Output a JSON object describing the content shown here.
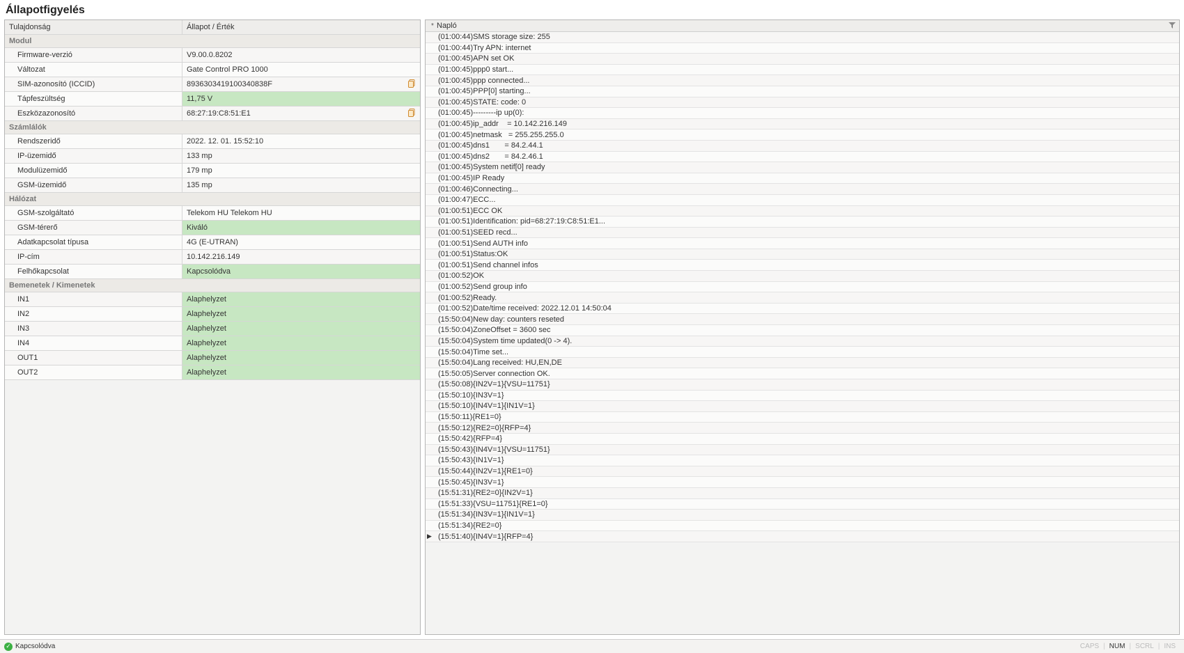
{
  "title": "Állapotfigyelés",
  "left": {
    "head_prop": "Tulajdonság",
    "head_val": "Állapot / Érték",
    "groups": [
      {
        "label": "Modul",
        "rows": [
          {
            "prop": "Firmware-verzió",
            "val": "V9.00.0.8202"
          },
          {
            "prop": "Változat",
            "val": "Gate Control PRO 1000"
          },
          {
            "prop": "SIM-azonosító (ICCID)",
            "val": "8936303419100340838F",
            "clip": true
          },
          {
            "prop": "Tápfeszültség",
            "val": "11,75 V",
            "hl": true
          },
          {
            "prop": "Eszközazonosító",
            "val": "68:27:19:C8:51:E1",
            "clip": true
          }
        ]
      },
      {
        "label": "Számlálók",
        "rows": [
          {
            "prop": "Rendszeridő",
            "val": "2022. 12. 01. 15:52:10"
          },
          {
            "prop": "IP-üzemidő",
            "val": "133 mp"
          },
          {
            "prop": "Modulüzemidő",
            "val": "179 mp"
          },
          {
            "prop": "GSM-üzemidő",
            "val": "135 mp"
          }
        ]
      },
      {
        "label": "Hálózat",
        "rows": [
          {
            "prop": "GSM-szolgáltató",
            "val": "Telekom HU Telekom HU"
          },
          {
            "prop": "GSM-térerő",
            "val": "Kiváló",
            "hl": true
          },
          {
            "prop": "Adatkapcsolat típusa",
            "val": "4G (E-UTRAN)"
          },
          {
            "prop": "IP-cím",
            "val": "10.142.216.149"
          },
          {
            "prop": "Felhőkapcsolat",
            "val": "Kapcsolódva",
            "hl": true
          }
        ]
      },
      {
        "label": "Bemenetek / Kimenetek",
        "rows": [
          {
            "prop": "IN1",
            "val": "Alaphelyzet",
            "hl": true
          },
          {
            "prop": "IN2",
            "val": "Alaphelyzet",
            "hl": true
          },
          {
            "prop": "IN3",
            "val": "Alaphelyzet",
            "hl": true
          },
          {
            "prop": "IN4",
            "val": "Alaphelyzet",
            "hl": true
          },
          {
            "prop": "OUT1",
            "val": "Alaphelyzet",
            "hl": true
          },
          {
            "prop": "OUT2",
            "val": "Alaphelyzet",
            "hl": true
          }
        ]
      }
    ]
  },
  "log": {
    "head": "Napló",
    "lines": [
      "(01:00:44)SMS storage size: 255",
      "(01:00:44)Try APN: internet",
      "(01:00:45)APN set OK",
      "(01:00:45)ppp0 start...",
      "(01:00:45)ppp connected...",
      "(01:00:45)PPP[0] starting...",
      "(01:00:45)STATE: code: 0",
      "(01:00:45)---------ip up(0):",
      "(01:00:45)ip_addr    = 10.142.216.149",
      "(01:00:45)netmask   = 255.255.255.0",
      "(01:00:45)dns1       = 84.2.44.1",
      "(01:00:45)dns2       = 84.2.46.1",
      "(01:00:45)System netif[0] ready",
      "(01:00:45)IP Ready",
      "(01:00:46)Connecting...",
      "(01:00:47)ECC...",
      "(01:00:51)ECC OK",
      "(01:00:51)Identification: pid=68:27:19:C8:51:E1...",
      "(01:00:51)SEED recd...",
      "(01:00:51)Send AUTH info",
      "(01:00:51)Status:OK",
      "(01:00:51)Send channel infos",
      "(01:00:52)OK",
      "(01:00:52)Send group info",
      "(01:00:52)Ready.",
      "(01:00:52)Date/time received: 2022.12.01 14:50:04",
      "(15:50:04)New day: counters reseted",
      "(15:50:04)ZoneOffset = 3600 sec",
      "(15:50:04)System time updated(0 -> 4).",
      "(15:50:04)Time set...",
      "(15:50:04)Lang received: HU,EN,DE",
      "(15:50:05)Server connection OK.",
      "(15:50:08){IN2V=1}{VSU=11751}",
      "(15:50:10){IN3V=1}",
      "(15:50:10){IN4V=1}{IN1V=1}",
      "(15:50:11){RE1=0}",
      "(15:50:12){RE2=0}{RFP=4}",
      "(15:50:42){RFP=4}",
      "(15:50:43){IN4V=1}{VSU=11751}",
      "(15:50:43){IN1V=1}",
      "(15:50:44){IN2V=1}{RE1=0}",
      "(15:50:45){IN3V=1}",
      "(15:51:31){RE2=0}{IN2V=1}",
      "(15:51:33){VSU=11751}{RE1=0}",
      "(15:51:34){IN3V=1}{IN1V=1}",
      "(15:51:34){RE2=0}",
      "(15:51:40){IN4V=1}{RFP=4}"
    ],
    "active_index": 46
  },
  "status": {
    "text": "Kapcsolódva",
    "caps": "CAPS",
    "num": "NUM",
    "scrl": "SCRL",
    "ins": "INS"
  }
}
